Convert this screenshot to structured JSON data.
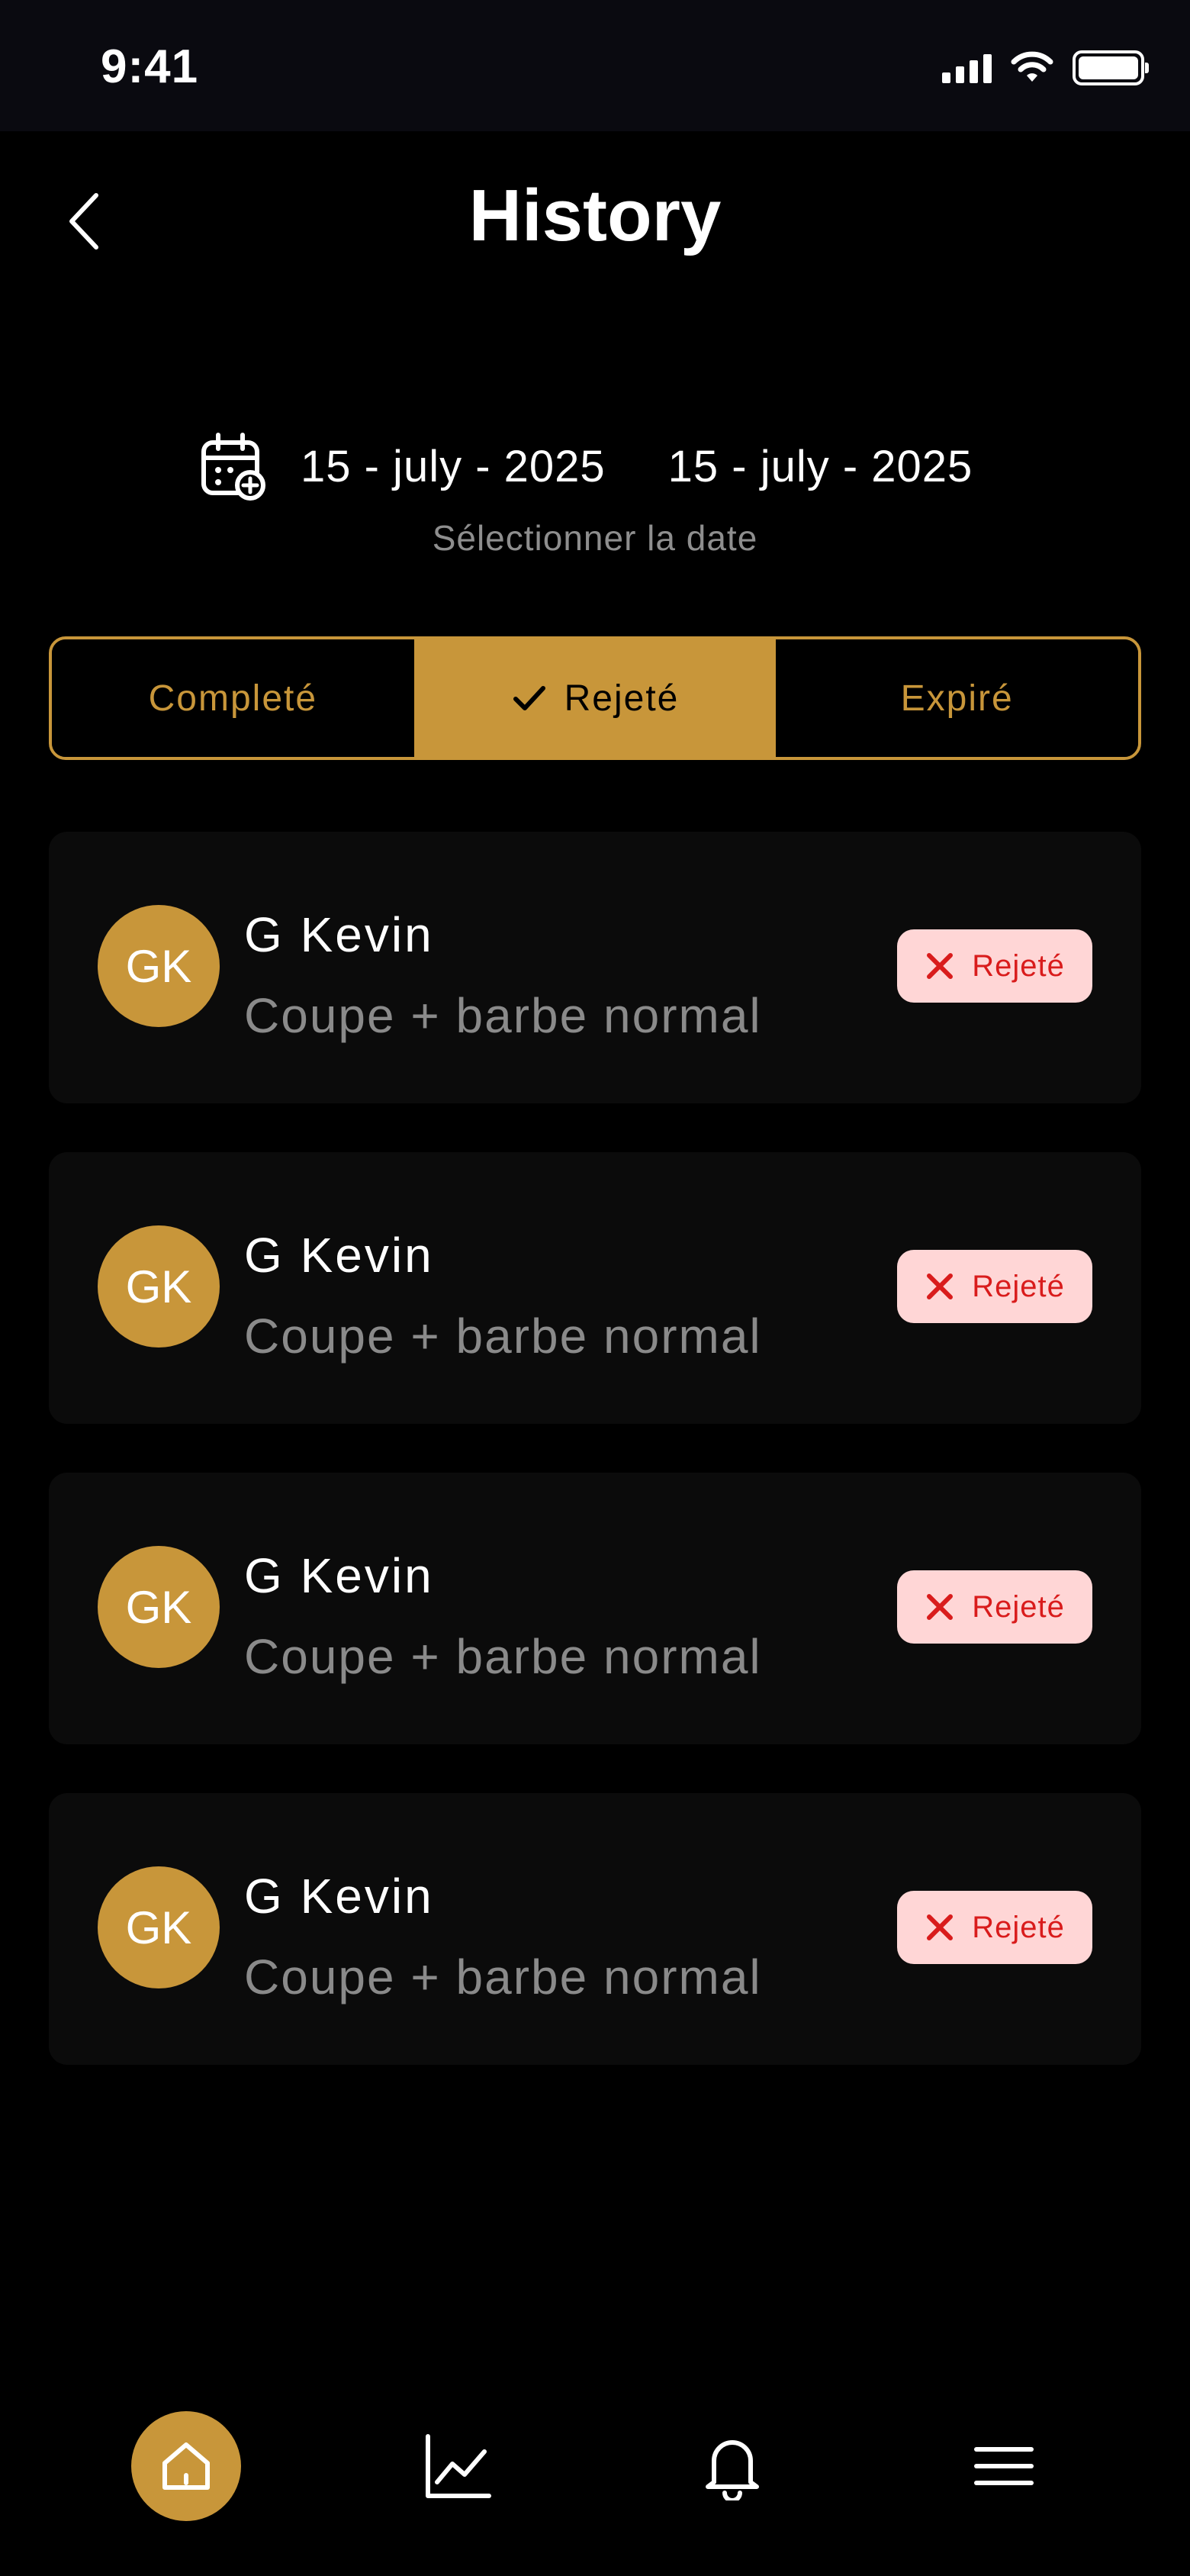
{
  "status_bar": {
    "time": "9:41"
  },
  "header": {
    "title": "History",
    "back_icon": "chevron-left-icon"
  },
  "date_range": {
    "start": "15 - july - 2025",
    "end": "15 - july - 2025",
    "hint": "Sélectionner la date",
    "icon": "calendar-add-icon"
  },
  "tabs": [
    {
      "label": "Completé",
      "active": false
    },
    {
      "label": "Rejeté",
      "active": true
    },
    {
      "label": "Expiré",
      "active": false
    }
  ],
  "history": [
    {
      "initials": "GK",
      "name": "G Kevin",
      "service": "Coupe + barbe normal",
      "status": "Rejeté"
    },
    {
      "initials": "GK",
      "name": "G Kevin",
      "service": "Coupe + barbe normal",
      "status": "Rejeté"
    },
    {
      "initials": "GK",
      "name": "G Kevin",
      "service": "Coupe + barbe normal",
      "status": "Rejeté"
    },
    {
      "initials": "GK",
      "name": "G Kevin",
      "service": "Coupe + barbe normal",
      "status": "Rejeté"
    }
  ],
  "bottom_nav": {
    "items": [
      {
        "icon": "home-icon",
        "active": true
      },
      {
        "icon": "chart-icon",
        "active": false
      },
      {
        "icon": "bell-icon",
        "active": false
      },
      {
        "icon": "menu-icon",
        "active": false
      }
    ]
  },
  "colors": {
    "accent": "#c8963a",
    "background": "#000000",
    "card": "#0b0b0b",
    "badge_bg": "#ffd6d6",
    "badge_text": "#d91c1c"
  }
}
